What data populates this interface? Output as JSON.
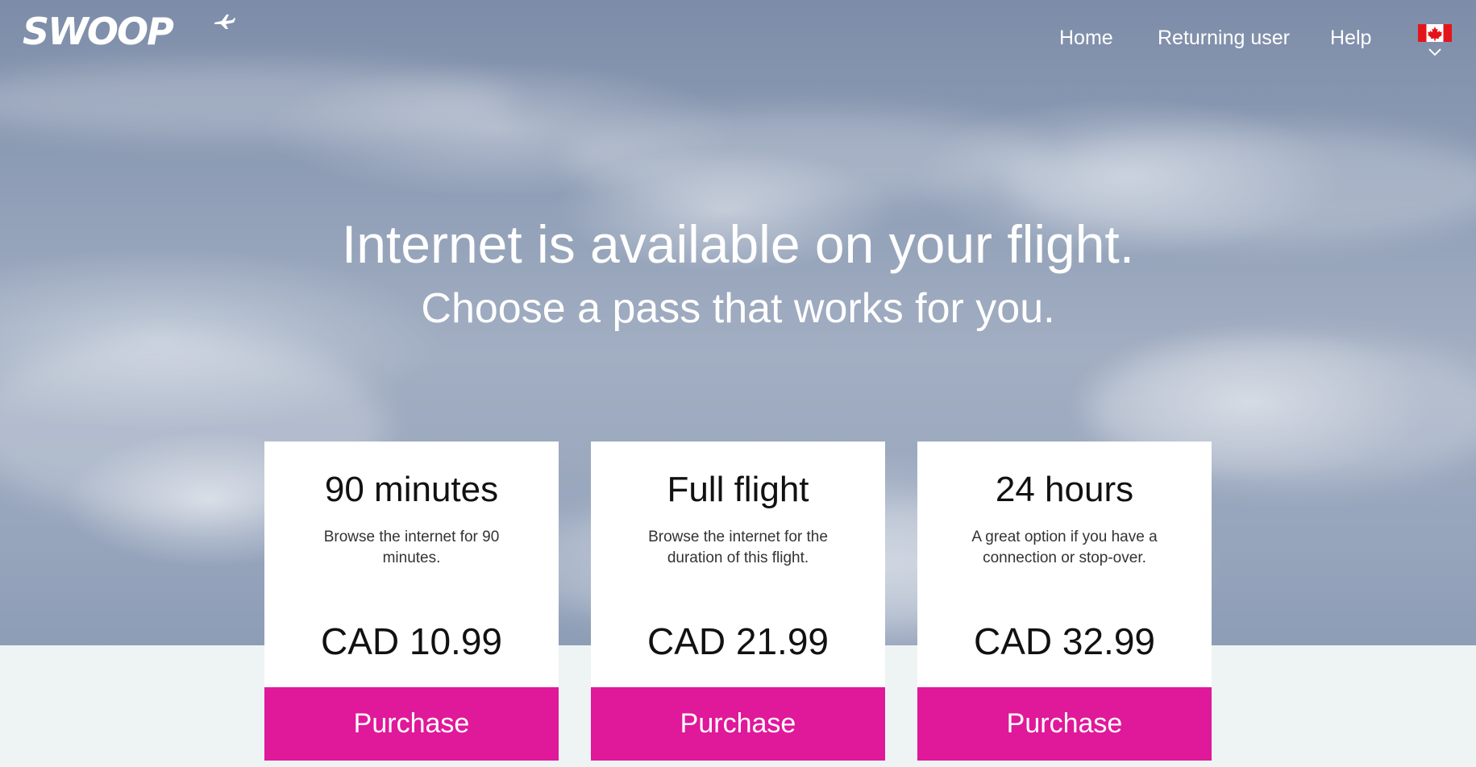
{
  "brand": {
    "logo_text": "SWOOP",
    "logo_icon": "airplane-icon"
  },
  "nav": {
    "home": "Home",
    "returning_user": "Returning user",
    "help": "Help",
    "language_flag": "canada-flag-icon",
    "language_dropdown_icon": "chevron-down-icon"
  },
  "hero": {
    "headline": "Internet is available on your flight.",
    "subheadline": "Choose a pass that works for you."
  },
  "plans": [
    {
      "title": "90 minutes",
      "description": "Browse the internet for 90 minutes.",
      "price": "CAD 10.99",
      "button": "Purchase"
    },
    {
      "title": "Full flight",
      "description": "Browse the internet for the duration of this flight.",
      "price": "CAD 21.99",
      "button": "Purchase"
    },
    {
      "title": "24 hours",
      "description": "A great option if you have a connection or stop-over.",
      "price": "CAD 32.99",
      "button": "Purchase"
    }
  ],
  "colors": {
    "accent": "#e0189a",
    "card_background": "#ffffff",
    "page_background": "#eef3f4"
  }
}
